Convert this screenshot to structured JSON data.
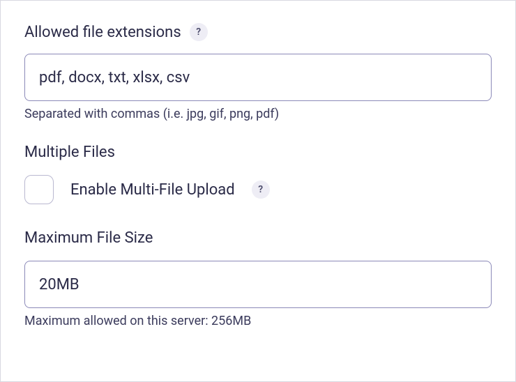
{
  "allowedExtensions": {
    "label": "Allowed file extensions",
    "help": "?",
    "value": "pdf, docx, txt, xlsx, csv",
    "hint": "Separated with commas (i.e. jpg, gif, png, pdf)"
  },
  "multipleFiles": {
    "heading": "Multiple Files",
    "checkboxLabel": "Enable Multi-File Upload",
    "help": "?"
  },
  "maxFileSize": {
    "label": "Maximum File Size",
    "value": "20MB",
    "hint": "Maximum allowed on this server: 256MB"
  }
}
